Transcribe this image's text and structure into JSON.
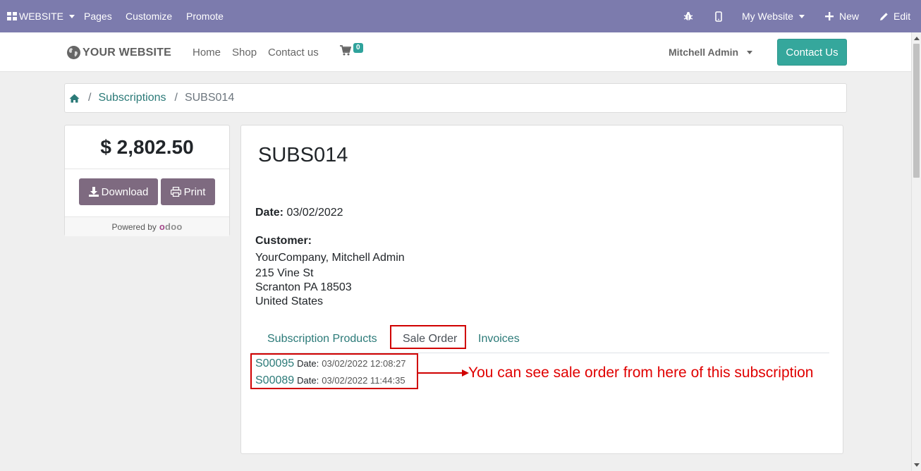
{
  "admin_bar": {
    "website_menu": "WEBSITE",
    "pages": "Pages",
    "customize": "Customize",
    "promote": "Promote",
    "my_website": "My Website",
    "new": "New",
    "edit": "Edit",
    "icons": [
      "apps-grid-icon",
      "bug-icon",
      "mobile-icon",
      "plus-icon",
      "pencil-icon"
    ]
  },
  "header": {
    "logo": "YOUR WEBSITE",
    "nav": [
      "Home",
      "Shop",
      "Contact us"
    ],
    "cart_count": "0",
    "user": "Mitchell Admin",
    "contact_button": "Contact Us"
  },
  "breadcrumb": {
    "items": [
      "Subscriptions",
      "SUBS014"
    ]
  },
  "sidebar": {
    "amount": "$ 2,802.50",
    "download": "Download",
    "print": "Print",
    "powered_by": "Powered by",
    "powered_brand": "odoo"
  },
  "document": {
    "title": "SUBS014",
    "date_label": "Date:",
    "date_value": "03/02/2022",
    "customer_label": "Customer:",
    "customer_lines": [
      "YourCompany, Mitchell Admin",
      "215 Vine St",
      "Scranton PA 18503",
      "United States"
    ]
  },
  "tabs": [
    "Subscription Products",
    "Sale Order",
    "Invoices"
  ],
  "active_tab": "Sale Order",
  "sale_orders": [
    {
      "number": "S00095",
      "date_label": "Date:",
      "date": "03/02/2022 12:08:27"
    },
    {
      "number": "S00089",
      "date_label": "Date:",
      "date": "03/02/2022 11:44:35"
    }
  ],
  "annotation": "You can see sale order from here of this subscription",
  "colors": {
    "admin_bar": "#7c7bad",
    "accent": "#35a79c",
    "link": "#2b7a78",
    "button": "#7e6a80",
    "annotation": "#e00000"
  }
}
